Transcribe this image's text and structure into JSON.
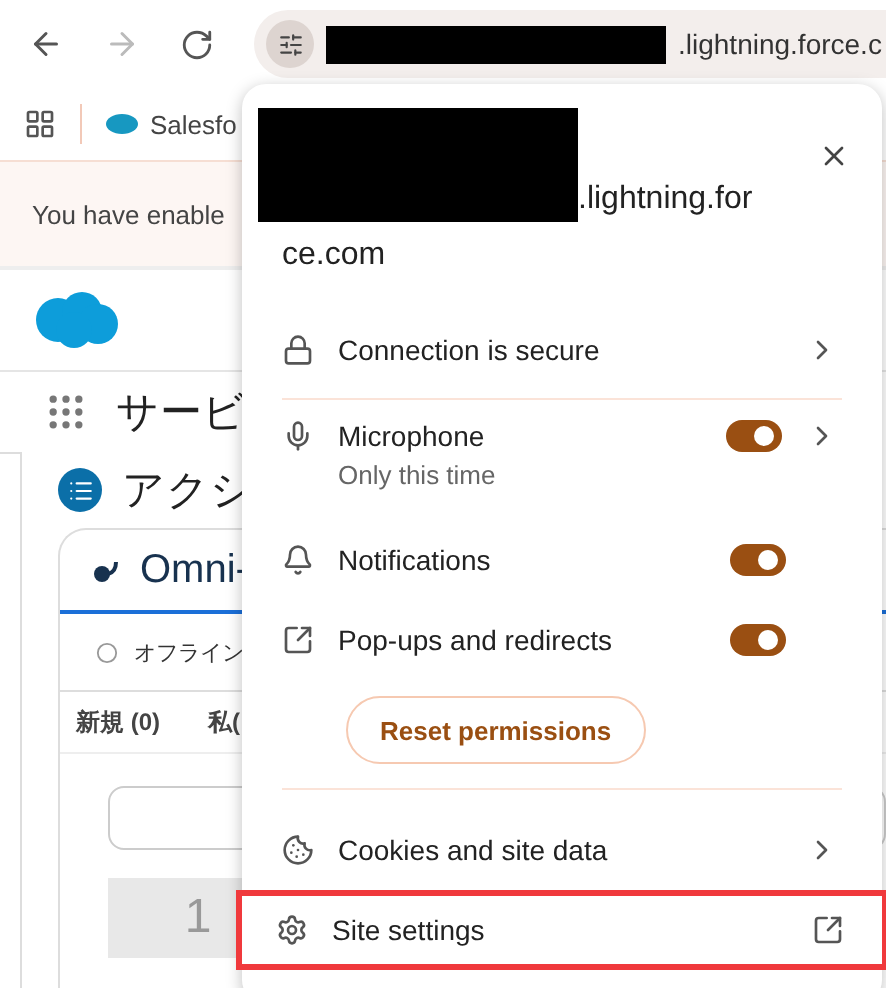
{
  "toolbar": {
    "url_suffix": ".lightning.force.c"
  },
  "bookmarks": [
    {
      "label": "Salesfo"
    }
  ],
  "info_bar": {
    "text": "You have enable"
  },
  "page": {
    "app_name": "サービ",
    "section_title": "アクシ",
    "card_title": "Omni-",
    "status": "オフライン",
    "tabs": [
      {
        "label": "新規 (0)"
      },
      {
        "label": "私("
      }
    ],
    "count": "1"
  },
  "popup": {
    "title_lines": [
      ".lightning.for",
      "ce.com"
    ],
    "connection": {
      "label": "Connection is secure"
    },
    "permissions": [
      {
        "label": "Microphone",
        "sub": "Only this time",
        "on": true,
        "chevron": true
      },
      {
        "label": "Notifications",
        "on": true,
        "chevron": false
      },
      {
        "label": "Pop-ups and redirects",
        "on": true,
        "chevron": false
      }
    ],
    "reset_button": "Reset permissions",
    "links": [
      {
        "label": "Cookies and site data",
        "kind": "chevron",
        "highlighted": false
      },
      {
        "label": "Site settings",
        "kind": "external",
        "highlighted": true
      }
    ]
  }
}
